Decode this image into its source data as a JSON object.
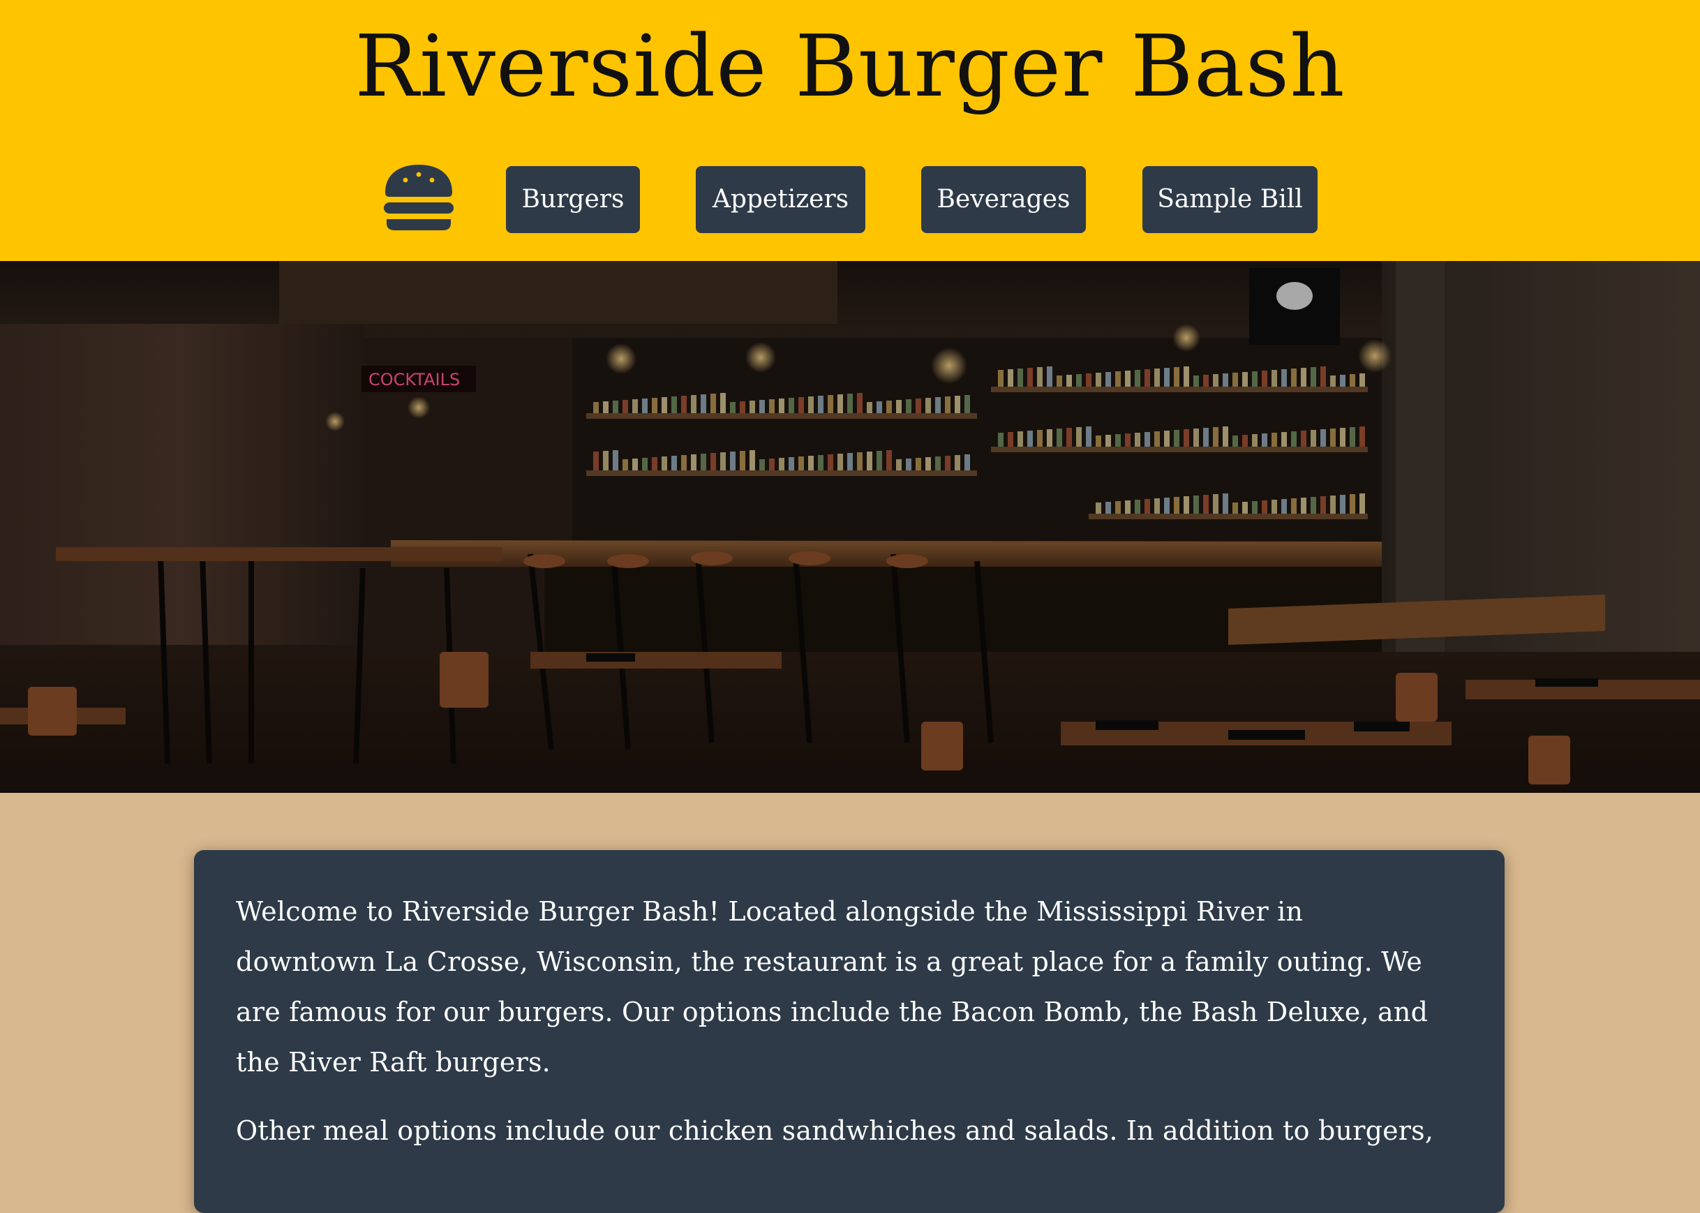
{
  "site": {
    "title": "Riverside Burger Bash"
  },
  "nav": {
    "logo_icon": "burger-icon",
    "items": [
      {
        "label": "Burgers"
      },
      {
        "label": "Appetizers"
      },
      {
        "label": "Beverages"
      },
      {
        "label": "Sample Bill"
      }
    ]
  },
  "hero": {
    "image": "restaurant-bar-interior",
    "sign_text": "COCKTAILS"
  },
  "intro": {
    "paragraphs": [
      "Welcome to Riverside Burger Bash! Located alongside the Mississippi River in downtown La Crosse, Wisconsin, the restaurant is a great place for a family outing. We are famous for our burgers. Our options include the Bacon Bomb, the Bash Deluxe, and the River Raft burgers.",
      "Other meal options include our chicken sandwhiches and salads. In addition to burgers,"
    ]
  },
  "colors": {
    "header_bg": "#ffc400",
    "nav_button_bg": "#2e3a48",
    "page_bg": "#d8b88e",
    "card_bg": "#2e3a48",
    "title_text": "#111111",
    "card_text": "#ffffff"
  }
}
